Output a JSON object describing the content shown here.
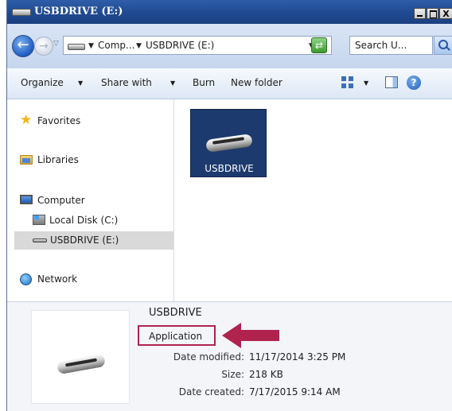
{
  "window": {
    "title": "USBDRIVE (E:)",
    "controls": {
      "minimize": "_",
      "maximize": "",
      "close": "X"
    }
  },
  "address_bar": {
    "breadcrumbs": [
      "Comp...",
      "USBDRIVE (E:)"
    ],
    "search_placeholder": "Search U..."
  },
  "toolbar": {
    "organize": "Organize",
    "share_with": "Share with",
    "burn": "Burn",
    "new_folder": "New folder",
    "help": "?"
  },
  "nav_pane": {
    "favorites": "Favorites",
    "libraries": "Libraries",
    "computer": "Computer",
    "local_disk": "Local Disk (C:)",
    "usbdrive": "USBDRIVE (E:)",
    "network": "Network"
  },
  "content": {
    "files": [
      {
        "name": "USBDRIVE",
        "icon": "usb-drive-icon",
        "selected": true
      }
    ]
  },
  "details": {
    "name": "USBDRIVE",
    "type": "Application",
    "fields": [
      {
        "key": "Date modified:",
        "value": "11/17/2014 3:25 PM"
      },
      {
        "key": "Size:",
        "value": "218 KB"
      },
      {
        "key": "Date created:",
        "value": "7/17/2015 9:14 AM"
      }
    ]
  },
  "annotation": {
    "highlight_color": "#b0234f"
  }
}
